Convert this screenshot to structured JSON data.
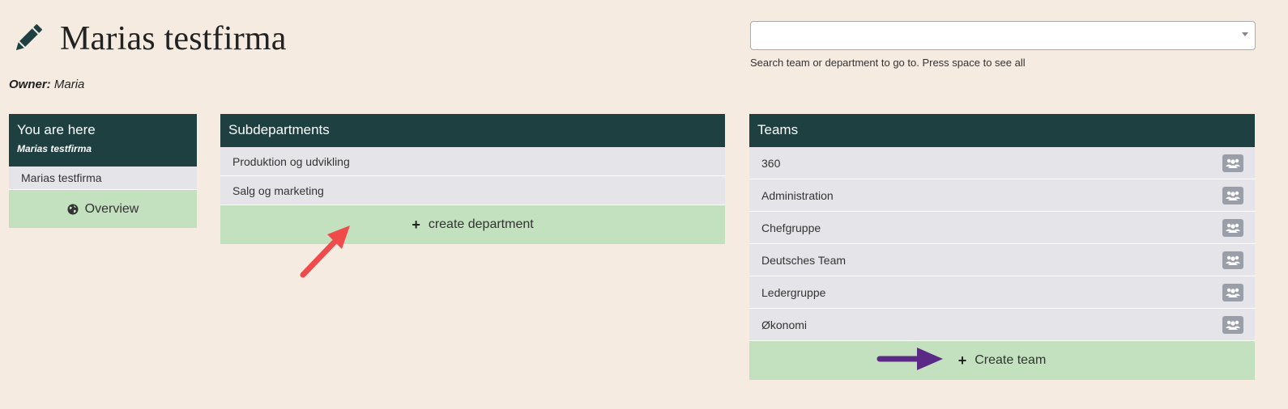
{
  "header": {
    "title": "Marias testfirma",
    "owner_label": "Owner:",
    "owner_name": "Maria"
  },
  "search": {
    "value": "",
    "placeholder": "",
    "help": "Search team or department to go to. Press space to see all"
  },
  "location_panel": {
    "title": "You are here",
    "subtitle": "Marias testfirma",
    "items": [
      {
        "label": "Marias testfirma"
      }
    ],
    "overview_label": "Overview"
  },
  "subdepartments_panel": {
    "title": "Subdepartments",
    "items": [
      {
        "label": "Produktion og udvikling"
      },
      {
        "label": "Salg og marketing"
      }
    ],
    "create_label": "create department"
  },
  "teams_panel": {
    "title": "Teams",
    "items": [
      {
        "label": "360"
      },
      {
        "label": "Administration"
      },
      {
        "label": "Chefgruppe"
      },
      {
        "label": "Deutsches Team"
      },
      {
        "label": "Ledergruppe"
      },
      {
        "label": "Økonomi"
      }
    ],
    "create_label": "Create team"
  },
  "icons": {
    "edit": "pencil-icon",
    "overview": "globe-icon",
    "add": "plus-icon",
    "team": "users-icon",
    "dropdown": "chevron-down-icon"
  },
  "colors": {
    "background": "#f5ebe0",
    "header": "#1e4040",
    "row": "#e5e5e9",
    "action": "#c3e0bf",
    "annotation_red": "#f04a4a",
    "annotation_purple": "#5b2a86"
  }
}
